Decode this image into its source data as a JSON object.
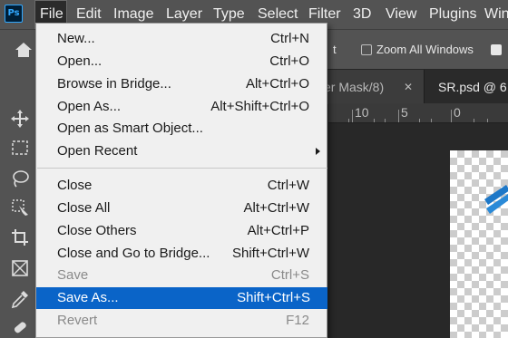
{
  "app": {
    "logo": "Ps"
  },
  "menubar": {
    "items": [
      "File",
      "Edit",
      "Image",
      "Layer",
      "Type",
      "Select",
      "Filter",
      "3D",
      "View",
      "Plugins",
      "Win"
    ]
  },
  "options": {
    "partial_label": "t",
    "zoom_all_windows": "Zoom All Windows"
  },
  "tabs": {
    "expand_glyph": "»",
    "inactive_tab_label": "er Mask/8)",
    "inactive_close": "✕",
    "active_tab_label": "SR.psd @ 6"
  },
  "ruler": {
    "labels": [
      "10",
      "5",
      "0"
    ]
  },
  "file_menu": {
    "items": [
      {
        "label": "New...",
        "shortcut": "Ctrl+N"
      },
      {
        "label": "Open...",
        "shortcut": "Ctrl+O"
      },
      {
        "label": "Browse in Bridge...",
        "shortcut": "Alt+Ctrl+O"
      },
      {
        "label": "Open As...",
        "shortcut": "Alt+Shift+Ctrl+O"
      },
      {
        "label": "Open as Smart Object...",
        "shortcut": ""
      },
      {
        "label": "Open Recent",
        "shortcut": ""
      },
      {
        "label": "Close",
        "shortcut": "Ctrl+W"
      },
      {
        "label": "Close All",
        "shortcut": "Alt+Ctrl+W"
      },
      {
        "label": "Close Others",
        "shortcut": "Alt+Ctrl+P"
      },
      {
        "label": "Close and Go to Bridge...",
        "shortcut": "Shift+Ctrl+W"
      },
      {
        "label": "Save",
        "shortcut": "Ctrl+S"
      },
      {
        "label": "Save As...",
        "shortcut": "Shift+Ctrl+S"
      },
      {
        "label": "Revert",
        "shortcut": "F12"
      }
    ]
  },
  "colors": {
    "highlight": "#0a64c8",
    "menubar": "#535353",
    "workspace": "#282828"
  },
  "icons": {
    "toolbar": [
      "move-icon",
      "marquee-icon",
      "lasso-icon",
      "quick-select-icon",
      "crop-icon",
      "frame-icon",
      "eyedropper-icon",
      "healing-brush-icon"
    ],
    "options": [
      "home-icon"
    ]
  }
}
